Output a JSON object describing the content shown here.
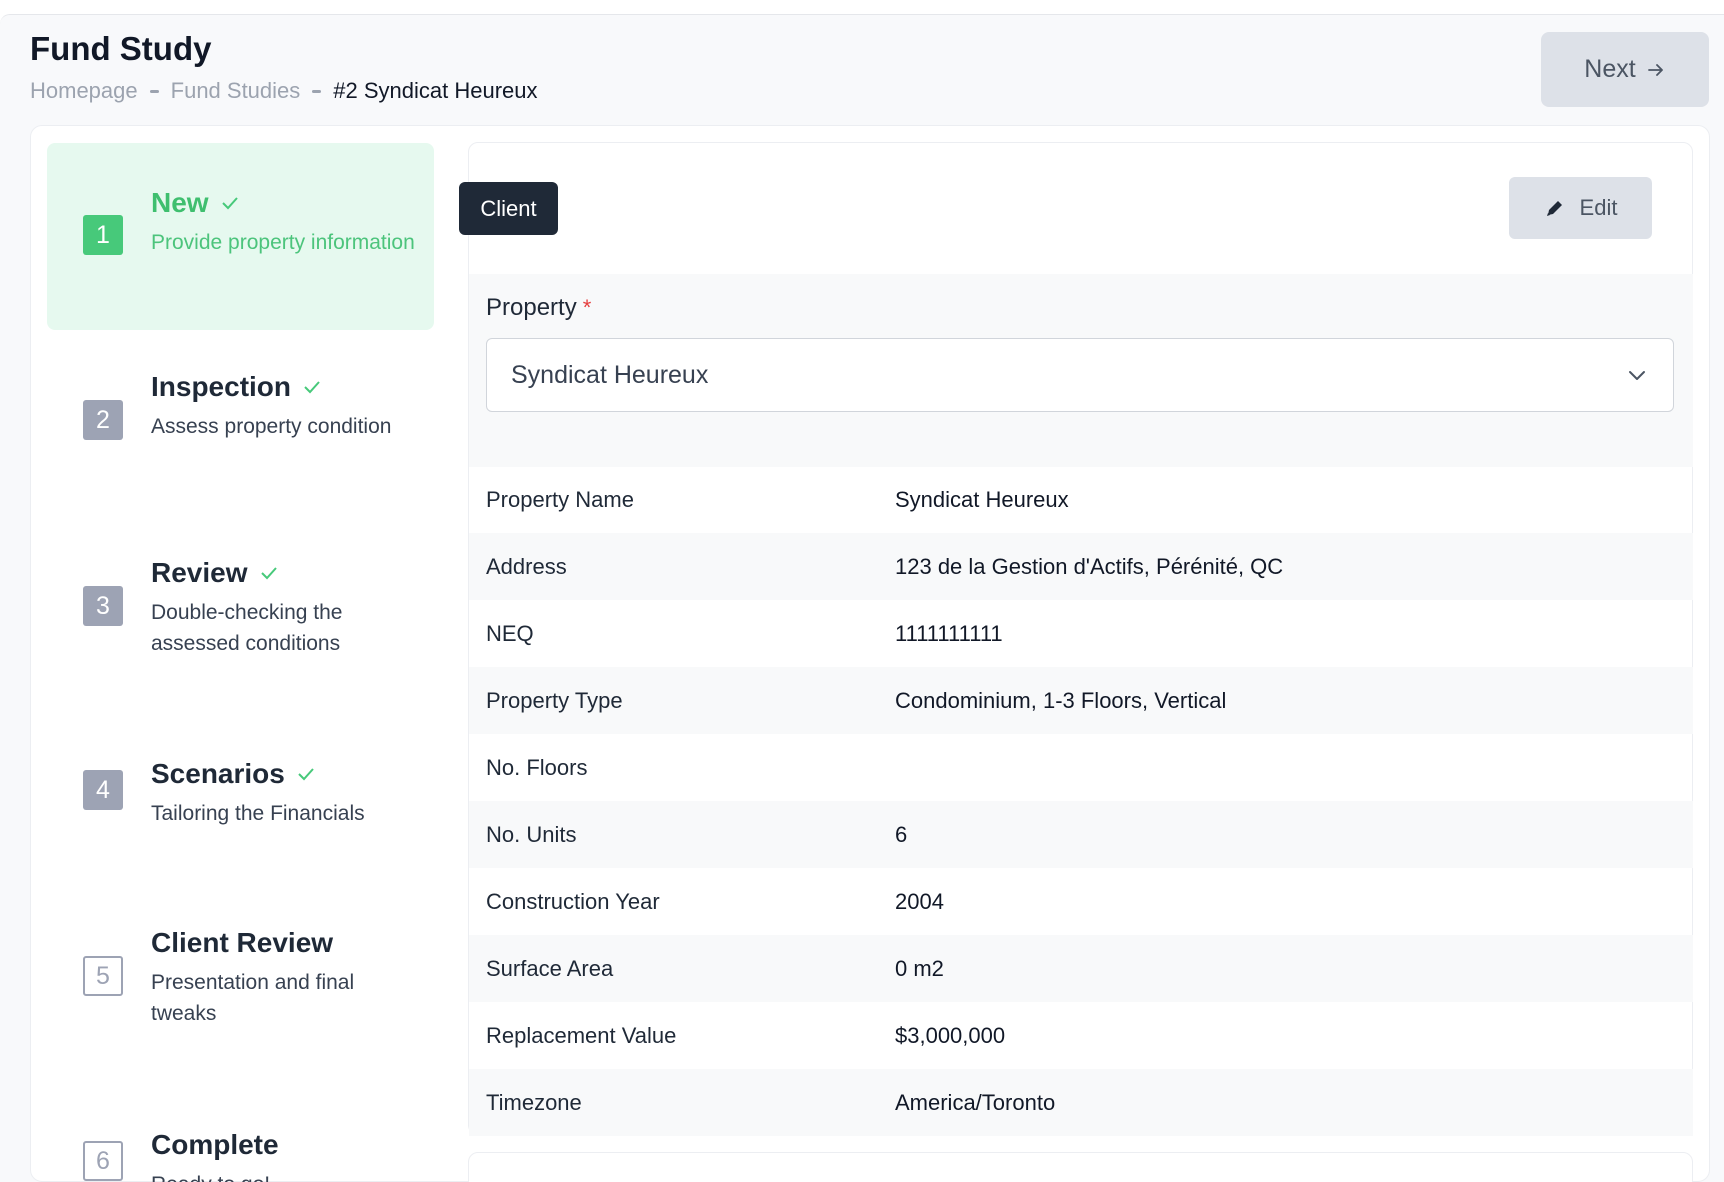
{
  "header": {
    "title": "Fund Study",
    "breadcrumb": [
      "Homepage",
      "Fund Studies",
      "#2 Syndicat Heureux"
    ],
    "next_label": "Next"
  },
  "steps": [
    {
      "number": "1",
      "title": "New",
      "desc": "Provide property information",
      "done": true,
      "active": true
    },
    {
      "number": "2",
      "title": "Inspection",
      "desc": "Assess property condition",
      "done": true
    },
    {
      "number": "3",
      "title": "Review",
      "desc": "Double-checking the assessed conditions",
      "done": true
    },
    {
      "number": "4",
      "title": "Scenarios",
      "desc": "Tailoring the Financials",
      "done": true
    },
    {
      "number": "5",
      "title": "Client Review",
      "desc": "Presentation and final tweaks",
      "done": false
    },
    {
      "number": "6",
      "title": "Complete",
      "desc": "Ready to go!",
      "done": false
    }
  ],
  "panel": {
    "tab_label": "Client",
    "edit_label": "Edit",
    "property_label": "Property",
    "required_mark": "*",
    "property_value": "Syndicat Heureux"
  },
  "details": [
    {
      "label": "Property Name",
      "value": "Syndicat Heureux"
    },
    {
      "label": "Address",
      "value": "123 de la Gestion d'Actifs, Pérénité, QC"
    },
    {
      "label": "NEQ",
      "value": "1111111111"
    },
    {
      "label": "Property Type",
      "value": "Condominium, 1-3 Floors, Vertical"
    },
    {
      "label": "No. Floors",
      "value": ""
    },
    {
      "label": "No. Units",
      "value": "6"
    },
    {
      "label": "Construction Year",
      "value": "2004"
    },
    {
      "label": "Surface Area",
      "value": "0 m2"
    },
    {
      "label": "Replacement Value",
      "value": "$3,000,000"
    },
    {
      "label": "Timezone",
      "value": "America/Toronto"
    }
  ],
  "colors": {
    "accent_green": "#47c97a",
    "dark": "#1f2937",
    "required": "#e53e3e"
  },
  "icons": {
    "check": "check-icon",
    "edit": "pencil-icon",
    "next": "arrow-right-icon",
    "select": "chevron-down-icon"
  }
}
